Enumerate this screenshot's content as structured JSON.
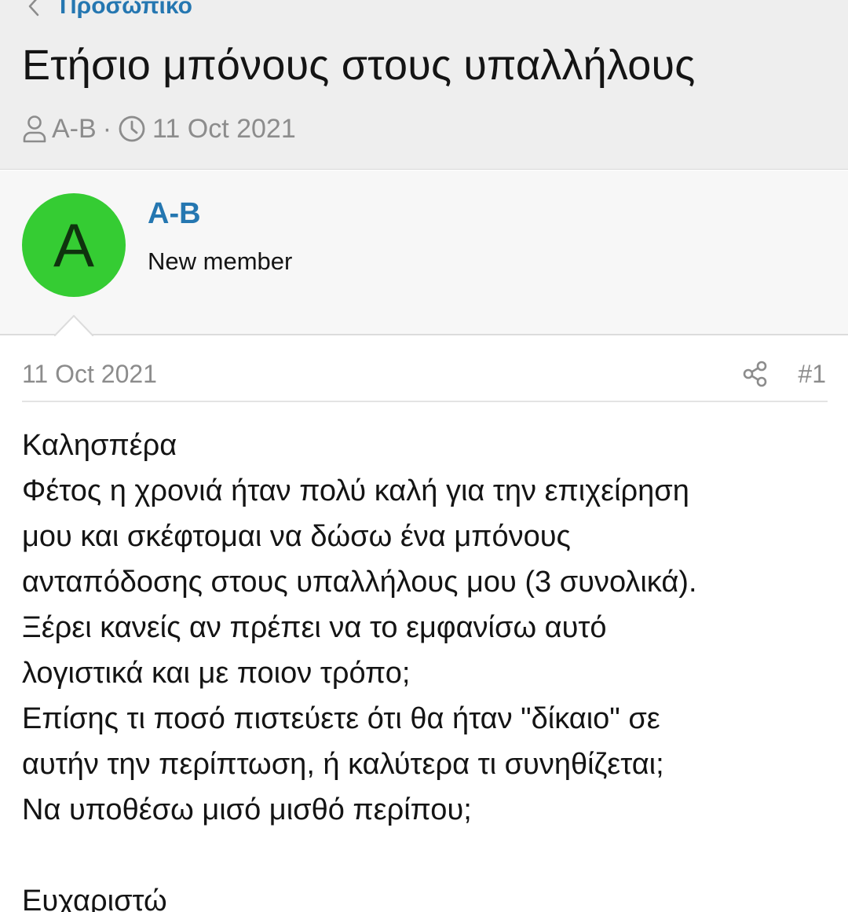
{
  "breadcrumb": {
    "label": "Προσωπικό"
  },
  "thread": {
    "title": "Ετήσιο μπόνους στους υπαλλήλους",
    "author": "A-B",
    "separator": "·",
    "date": "11 Oct 2021"
  },
  "user": {
    "avatar_letter": "A",
    "name": "A-B",
    "title": "New member",
    "avatar_color": "#35cc33"
  },
  "post": {
    "date": "11 Oct 2021",
    "number": "#1",
    "lines": [
      "Καλησπέρα",
      "Φέτος η χρονιά ήταν πολύ καλή για την επιχείρηση",
      "μου και σκέφτομαι να δώσω ένα μπόνους",
      "ανταπόδοσης στους υπαλλήλους μου (3 συνολικά).",
      "Ξέρει κανείς αν πρέπει να το εμφανίσω αυτό",
      "λογιστικά και με ποιον τρόπο;",
      "Επίσης τι ποσό πιστεύετε ότι θα ήταν \"δίκαιο\" σε",
      "αυτήν την περίπτωση, ή καλύτερα τι συνηθίζεται;",
      "Να υποθέσω μισό μισθό περίπου;"
    ],
    "closing": "Ευχαριστώ"
  },
  "colors": {
    "link": "#2577b1",
    "muted": "#8c8c8c",
    "header_bg": "#eeeeee"
  }
}
